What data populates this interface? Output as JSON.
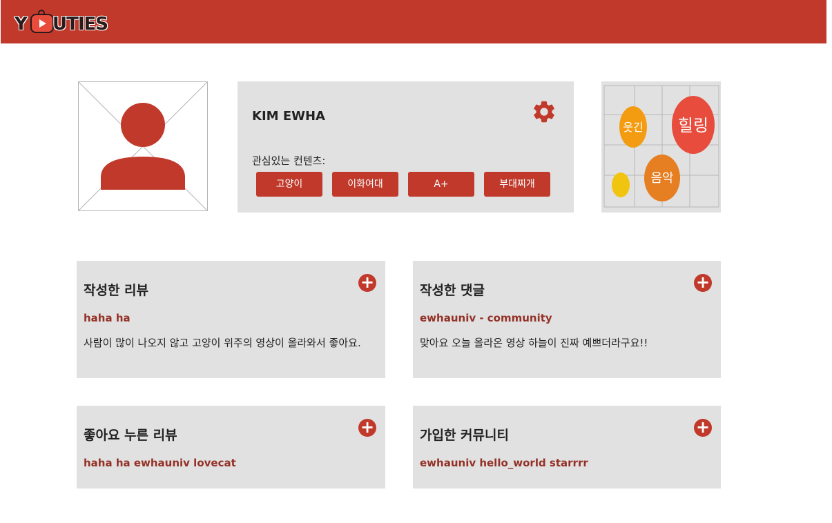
{
  "app": {
    "logo_prefix": "Y",
    "logo_suffix": "UTIES",
    "brand_color": "#c0392b"
  },
  "profile": {
    "name": "KIM EWHA",
    "interests_label": "관심있는 컨텐츠:",
    "tags": [
      "고양이",
      "이화여대",
      "A+",
      "부대찌개"
    ]
  },
  "word_cloud": {
    "words": [
      "웃긴",
      "힐링",
      "음악"
    ]
  },
  "cards": {
    "reviews": {
      "title": "작성한 리뷰",
      "link": "haha ha",
      "body": "사람이 많이 나오지 않고 고양이 위주의 영상이 올라와서 좋아요."
    },
    "comments": {
      "title": "작성한 댓글",
      "link": "ewhauniv - community",
      "body": "맞아요 오늘 올라온 영상 하늘이 진짜 예쁘더라구요!!"
    },
    "liked_reviews": {
      "title": "좋아요 누른 리뷰",
      "link": "haha ha ewhauniv lovecat"
    },
    "communities": {
      "title": "가입한 커뮤니티",
      "link": "ewhauniv hello_world starrrr"
    }
  }
}
